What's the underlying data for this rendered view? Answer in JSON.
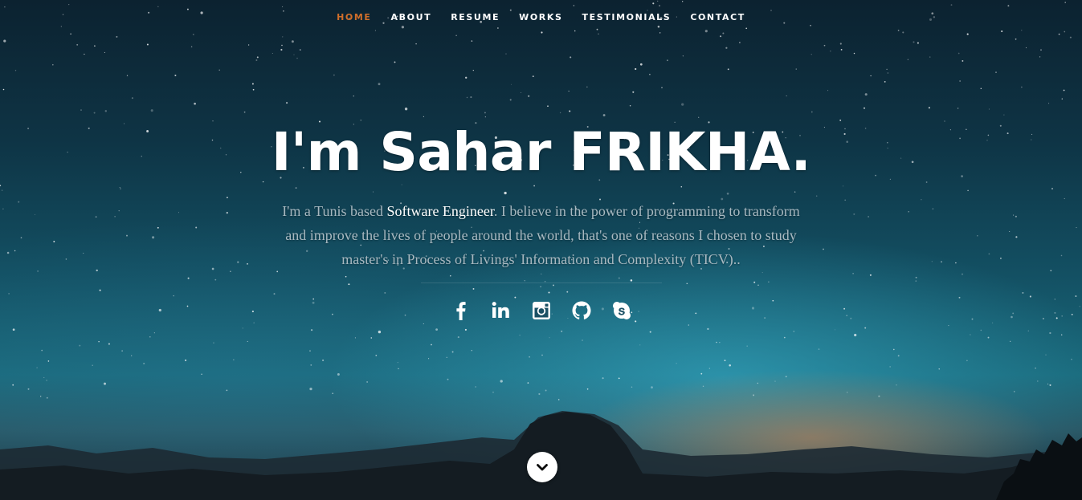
{
  "nav": {
    "items": [
      {
        "label": "HOME",
        "active": true
      },
      {
        "label": "ABOUT",
        "active": false
      },
      {
        "label": "RESUME",
        "active": false
      },
      {
        "label": "WORKS",
        "active": false
      },
      {
        "label": "TESTIMONIALS",
        "active": false
      },
      {
        "label": "CONTACT",
        "active": false
      }
    ],
    "active_color": "#cf6e2a"
  },
  "banner": {
    "headline": "I'm Sahar FRIKHA.",
    "intro_prefix": "I'm a Tunis based ",
    "intro_highlight": "Software Engineer",
    "intro_suffix": ". I believe in the power of programming to transform and improve the lives of people around the world, that's one of reasons I chosen to study master's in Process of Livings' Information and Complexity (TICV).."
  },
  "social": [
    {
      "icon": "facebook-icon"
    },
    {
      "icon": "linkedin-icon"
    },
    {
      "icon": "instagram-icon"
    },
    {
      "icon": "github-icon"
    },
    {
      "icon": "skype-icon"
    }
  ],
  "scroll_down": {
    "icon": "chevron-down-icon"
  }
}
